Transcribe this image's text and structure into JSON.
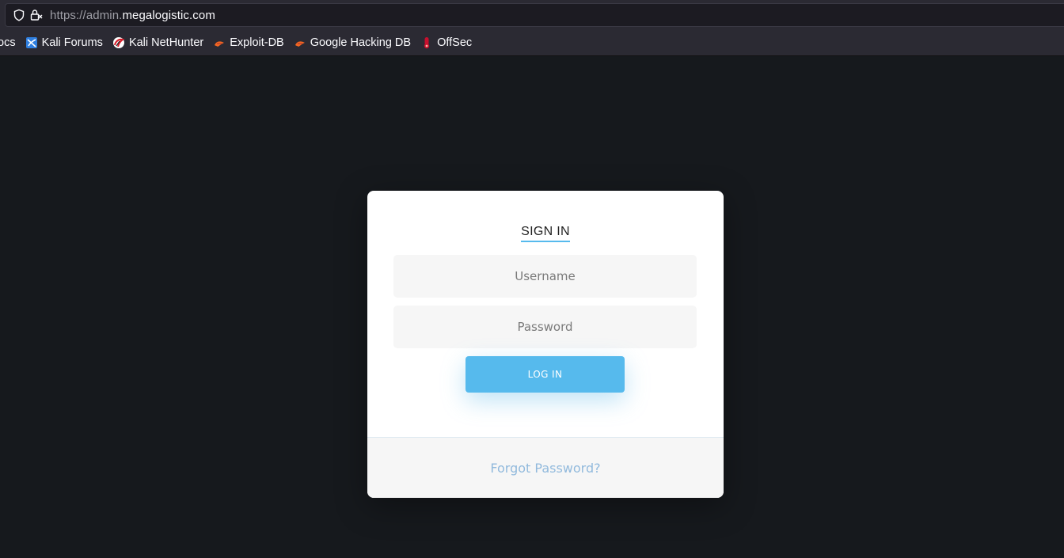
{
  "browser": {
    "url_prefix": "https://admin.",
    "url_domain": "megalogistic.com",
    "bookmarks": [
      {
        "label": "ocs",
        "icon": "none"
      },
      {
        "label": "Kali Forums",
        "icon": "kali-forums-icon"
      },
      {
        "label": "Kali NetHunter",
        "icon": "kali-nethunter-icon"
      },
      {
        "label": "Exploit-DB",
        "icon": "exploit-db-icon"
      },
      {
        "label": "Google Hacking DB",
        "icon": "ghdb-icon"
      },
      {
        "label": "OffSec",
        "icon": "offsec-icon"
      }
    ]
  },
  "login": {
    "title": "SIGN IN",
    "username_placeholder": "Username",
    "password_placeholder": "Password",
    "button_label": "LOG IN",
    "forgot_label": "Forgot Password?"
  },
  "colors": {
    "accent": "#56baed",
    "page_background": "#16191d",
    "forgot_link": "#92badd"
  }
}
